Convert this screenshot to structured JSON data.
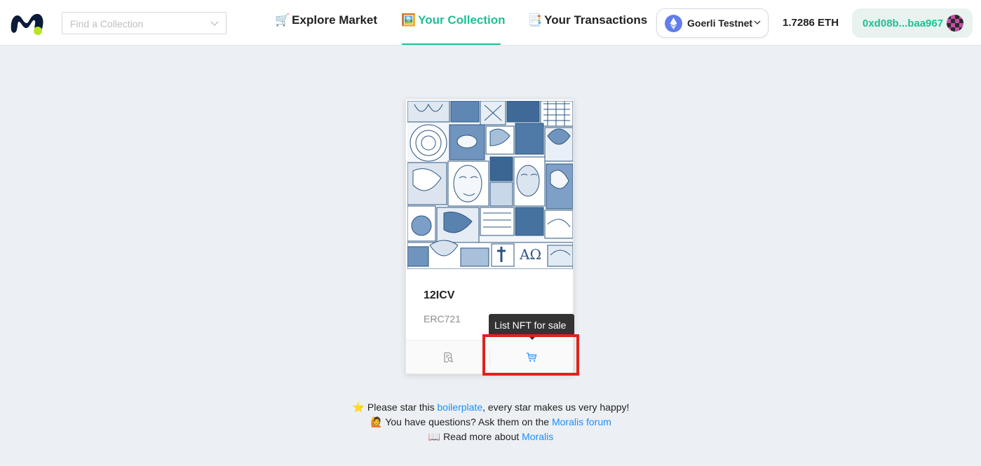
{
  "header": {
    "logo_name": "moralis-logo",
    "search": {
      "placeholder": "Find a Collection"
    },
    "nav": [
      {
        "icon": "🛒",
        "label": "Explore Market",
        "active": false
      },
      {
        "icon": "🖼️",
        "label": "Your Collection",
        "active": true
      },
      {
        "icon": "📑",
        "label": "Your Transactions",
        "active": false
      }
    ],
    "network": {
      "label": "Goerli Testnet",
      "icon": "ethereum-icon"
    },
    "balance": "1.7286 ETH",
    "account": {
      "address": "0xd08b...baa967"
    }
  },
  "card": {
    "name": "12ICV",
    "type": "ERC721",
    "tooltip": "List NFT for sale"
  },
  "footer": {
    "line1": {
      "icon": "⭐",
      "prefix": "Please star this ",
      "link": "boilerplate",
      "suffix": ", every star makes us very happy!"
    },
    "line2": {
      "icon": "🙋",
      "prefix": "You have questions? Ask them on the ",
      "link": "Moralis forum"
    },
    "line3": {
      "icon": "📖",
      "prefix": "Read more about ",
      "link": "Moralis"
    }
  },
  "colors": {
    "accent": "#21bf96",
    "link": "#1890ff",
    "highlight": "#e3201b",
    "eth": "#627eea"
  }
}
